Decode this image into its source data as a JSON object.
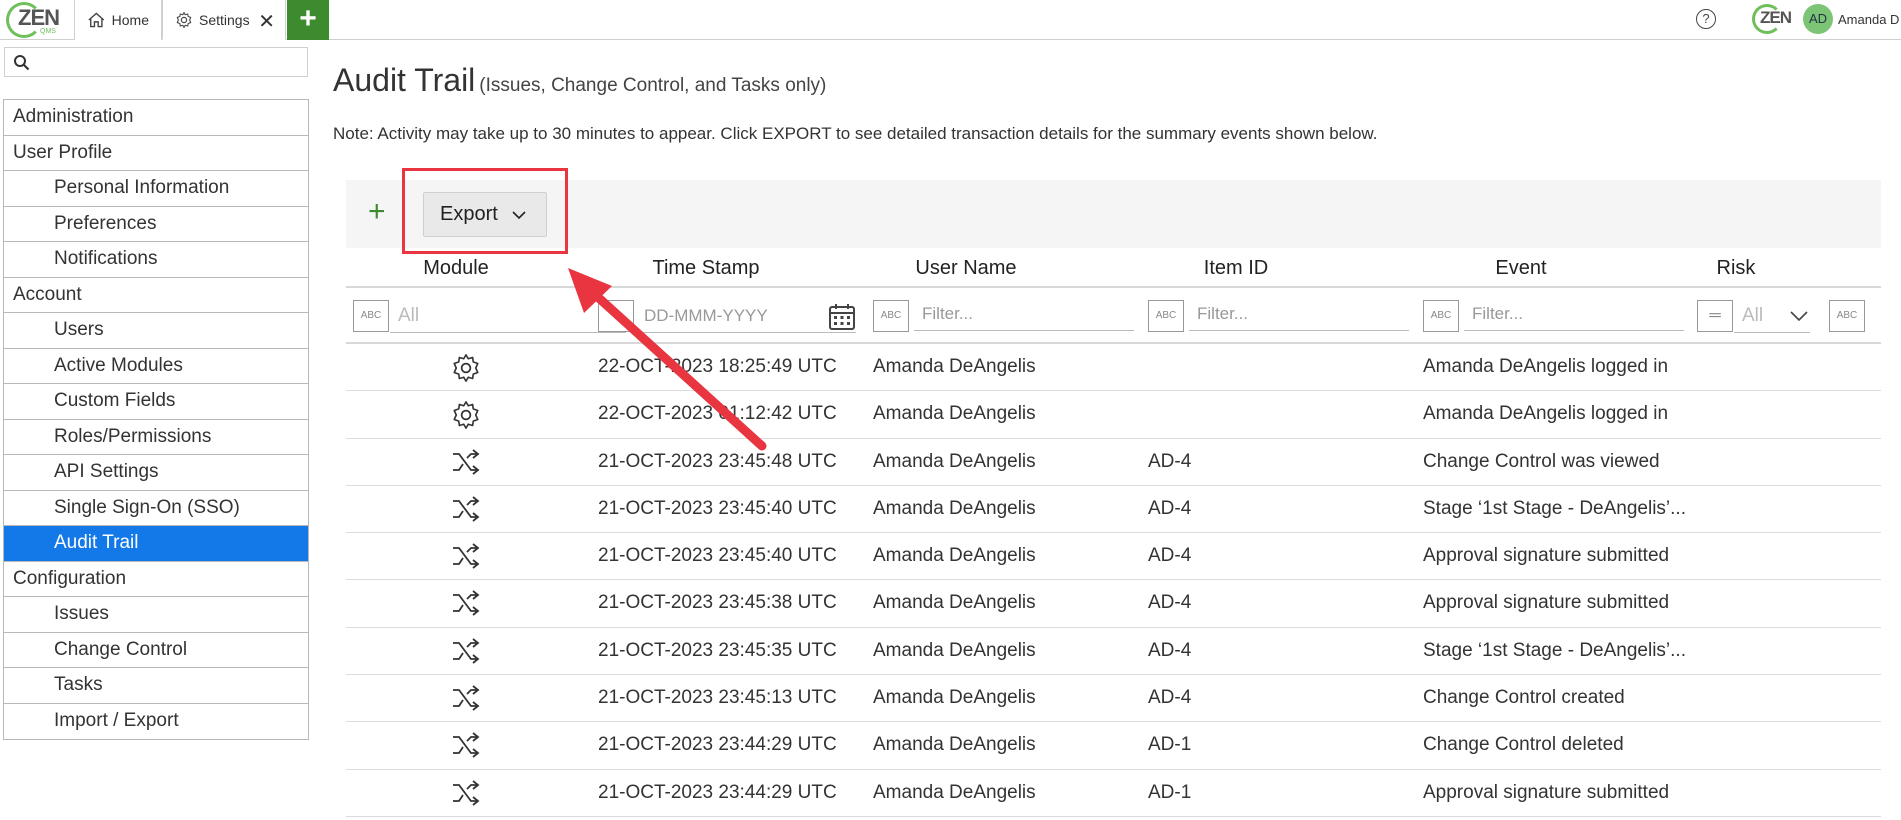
{
  "topbar": {
    "logo_text": "ZEN",
    "logo_sub": "QMS",
    "tabs": [
      {
        "label": "Home",
        "icon": "home-icon"
      },
      {
        "label": "Settings",
        "icon": "gear-icon"
      }
    ],
    "add_tab": "+",
    "help": "?",
    "avatar_initials": "AD",
    "user_name": "Amanda D"
  },
  "sidebar": {
    "search_placeholder": "",
    "items": [
      {
        "label": "Administration",
        "level": 0
      },
      {
        "label": "User Profile",
        "level": 0
      },
      {
        "label": "Personal Information",
        "level": 1
      },
      {
        "label": "Preferences",
        "level": 1
      },
      {
        "label": "Notifications",
        "level": 1
      },
      {
        "label": "Account",
        "level": 0
      },
      {
        "label": "Users",
        "level": 1
      },
      {
        "label": "Active Modules",
        "level": 1
      },
      {
        "label": "Custom Fields",
        "level": 1
      },
      {
        "label": "Roles/Permissions",
        "level": 1
      },
      {
        "label": "API Settings",
        "level": 1
      },
      {
        "label": "Single Sign-On (SSO)",
        "level": 1
      },
      {
        "label": "Audit Trail",
        "level": 1,
        "active": true
      },
      {
        "label": "Configuration",
        "level": 0
      },
      {
        "label": "Issues",
        "level": 1
      },
      {
        "label": "Change Control",
        "level": 1
      },
      {
        "label": "Tasks",
        "level": 1
      },
      {
        "label": "Import / Export",
        "level": 1
      }
    ]
  },
  "main": {
    "title": "Audit Trail",
    "subtitle": "(Issues, Change Control, and Tasks only)",
    "note": "Note: Activity may take up to 30 minutes to appear. Click EXPORT to see detailed transaction details for the summary events shown below.",
    "toolbar": {
      "add": "+",
      "export_label": "Export"
    },
    "columns": [
      "Module",
      "Time Stamp",
      "User Name",
      "Item ID",
      "Event",
      "Risk"
    ],
    "filters": {
      "module_value": "All",
      "date_placeholder": "DD-MMM-YYYY",
      "user_placeholder": "Filter...",
      "item_placeholder": "Filter...",
      "event_placeholder": "Filter...",
      "risk_value": "All",
      "text_filter_icon": "ABC"
    },
    "rows": [
      {
        "module": "gear-icon",
        "timestamp": "22-OCT-2023 18:25:49 UTC",
        "user": "Amanda DeAngelis",
        "item": "",
        "event": "Amanda DeAngelis logged in"
      },
      {
        "module": "gear-icon",
        "timestamp": "22-OCT-2023 01:12:42 UTC",
        "user": "Amanda DeAngelis",
        "item": "",
        "event": "Amanda DeAngelis logged in"
      },
      {
        "module": "shuffle-icon",
        "timestamp": "21-OCT-2023 23:45:48 UTC",
        "user": "Amanda DeAngelis",
        "item": "AD-4",
        "event": "Change Control was viewed"
      },
      {
        "module": "shuffle-icon",
        "timestamp": "21-OCT-2023 23:45:40 UTC",
        "user": "Amanda DeAngelis",
        "item": "AD-4",
        "event": "Stage ‘1st Stage - DeAngelis’..."
      },
      {
        "module": "shuffle-icon",
        "timestamp": "21-OCT-2023 23:45:40 UTC",
        "user": "Amanda DeAngelis",
        "item": "AD-4",
        "event": "Approval signature submitted"
      },
      {
        "module": "shuffle-icon",
        "timestamp": "21-OCT-2023 23:45:38 UTC",
        "user": "Amanda DeAngelis",
        "item": "AD-4",
        "event": "Approval signature submitted"
      },
      {
        "module": "shuffle-icon",
        "timestamp": "21-OCT-2023 23:45:35 UTC",
        "user": "Amanda DeAngelis",
        "item": "AD-4",
        "event": "Stage ‘1st Stage - DeAngelis’..."
      },
      {
        "module": "shuffle-icon",
        "timestamp": "21-OCT-2023 23:45:13 UTC",
        "user": "Amanda DeAngelis",
        "item": "AD-4",
        "event": "Change Control created"
      },
      {
        "module": "shuffle-icon",
        "timestamp": "21-OCT-2023 23:44:29 UTC",
        "user": "Amanda DeAngelis",
        "item": "AD-1",
        "event": "Change Control deleted"
      },
      {
        "module": "shuffle-icon",
        "timestamp": "21-OCT-2023 23:44:29 UTC",
        "user": "Amanda DeAngelis",
        "item": "AD-1",
        "event": "Approval signature submitted"
      }
    ]
  },
  "colors": {
    "accent_green": "#3d8b2f",
    "logo_green": "#6fbf5a",
    "active_blue": "#1479e8",
    "annotation_red": "#e8353f"
  }
}
